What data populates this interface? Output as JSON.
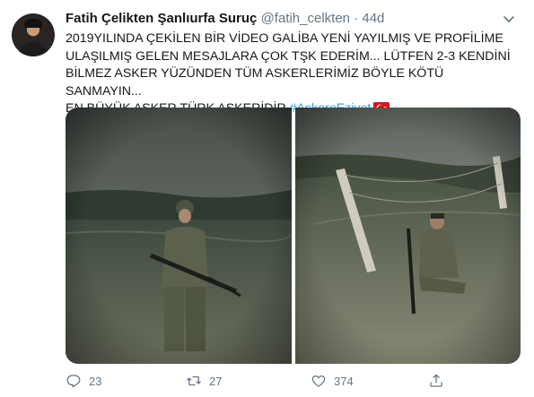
{
  "tweet": {
    "author_name": "Fatih Çelikten Şanlıurfa Suruç",
    "author_handle": "@fatih_celkten",
    "separator": "·",
    "time": "44d",
    "text_line1": "2019YILINDA ÇEKİLEN BİR VİDEO GALİBA YENİ YAYILMIŞ VE PROFİLİME",
    "text_line2": "ULAŞILMIŞ GELEN MESAJLARA ÇOK TŞK EDERİM... LÜTFEN 2-3 KENDİNİ",
    "text_line3": "BİLMEZ ASKER YÜZÜNDEN TÜM ASKERLERİMİZ BÖYLE KÖTÜ SANMAYIN...",
    "text_line4": "EN BÜYÜK ASKER TÜRK ASKERİDİR ",
    "hashtag": "#AskereEziyet",
    "flag_icon": "turkey-flag-emoji"
  },
  "actions": {
    "reply_count": "23",
    "retweet_count": "27",
    "like_count": "374",
    "icons": [
      "reply-icon",
      "retweet-icon",
      "like-icon",
      "share-icon"
    ]
  },
  "colors": {
    "link": "#1da1f2",
    "secondary_text": "#657786",
    "primary_text": "#14171a"
  }
}
